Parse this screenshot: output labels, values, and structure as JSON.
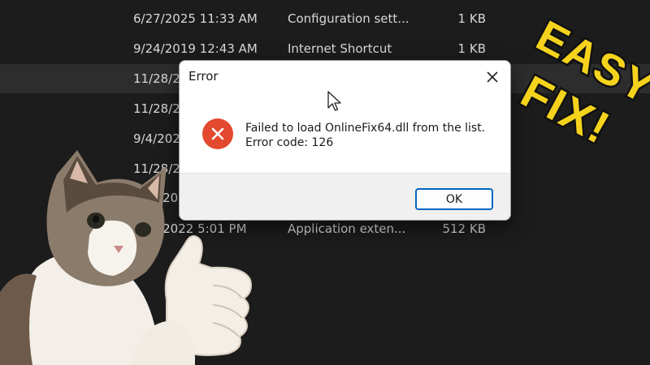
{
  "file_list": {
    "rows": [
      {
        "date": "6/27/2025 11:33 AM",
        "type": "Configuration sett...",
        "size": "1 KB"
      },
      {
        "date": "9/24/2019 12:43 AM",
        "type": "Internet Shortcut",
        "size": "1 KB"
      },
      {
        "date": "11/28/20",
        "type": "",
        "size": ""
      },
      {
        "date": "11/28/20",
        "type": "",
        "size": ""
      },
      {
        "date": "9/4/202",
        "type": "",
        "size": ""
      },
      {
        "date": "11/28/20",
        "type": "",
        "size": ""
      },
      {
        "date": "28/20",
        "type": "",
        "size": ""
      },
      {
        "date": "30/2022 5:01 PM",
        "type": "Application exten...",
        "size": "512 KB"
      }
    ]
  },
  "dialog": {
    "title": "Error",
    "message_line1": "Failed to load OnlineFix64.dll from the list.",
    "message_line2": "Error code: 126",
    "ok_label": "OK",
    "icon": "error-x-icon",
    "icon_color": "#e2492f"
  },
  "overlay": {
    "text_line1": "EASY",
    "text_line2": "FIX!",
    "text_color": "#f5d31c"
  }
}
